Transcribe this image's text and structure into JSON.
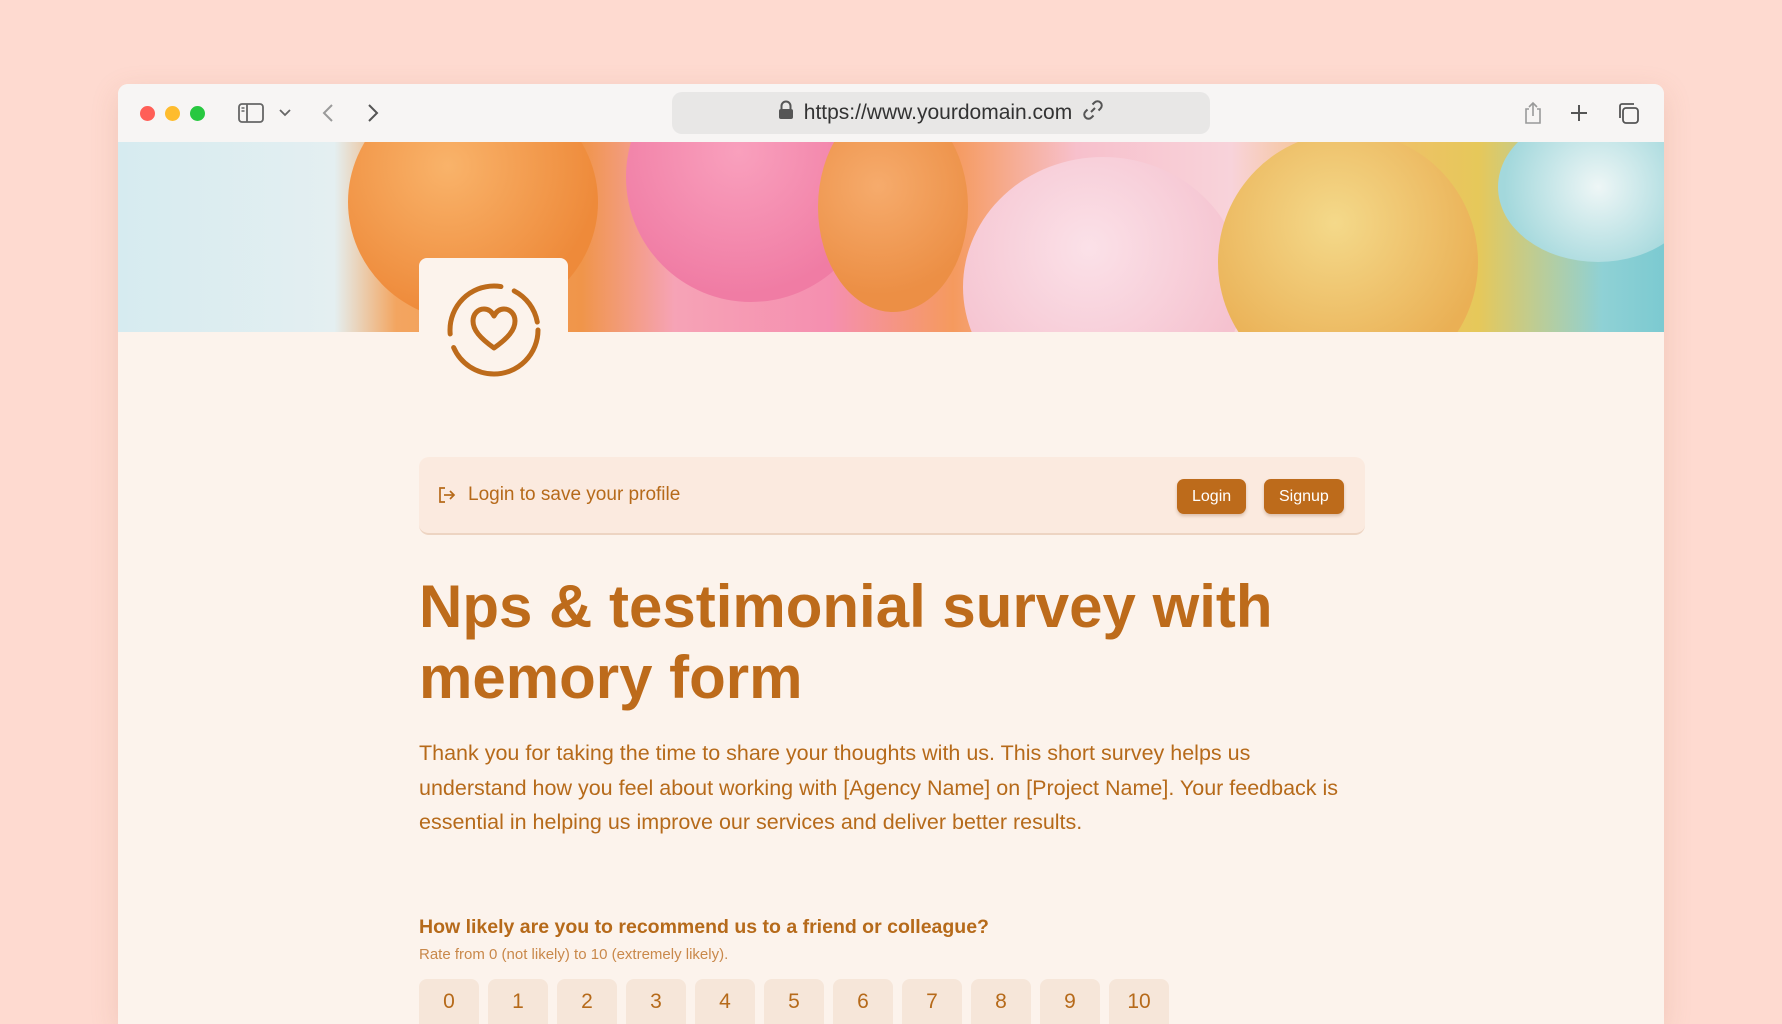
{
  "browser": {
    "url": "https://www.yourdomain.com",
    "icons": [
      "sidebar-icon",
      "chevron-down-icon",
      "back-icon",
      "forward-icon",
      "lock-icon",
      "link-icon",
      "share-icon",
      "plus-icon",
      "tabs-icon"
    ]
  },
  "login_bar": {
    "text": "Login to save your profile",
    "login_label": "Login",
    "signup_label": "Signup"
  },
  "form": {
    "title": "Nps & testimonial survey with memory form",
    "intro": "Thank you for taking the time to share your thoughts with us. This short survey helps us understand how you feel about working with [Agency Name] on [Project Name]. Your feedback is essential in helping us improve our services and deliver better results.",
    "question": "How likely are you to recommend us to a friend or colleague?",
    "hint": "Rate from 0 (not likely) to 10 (extremely likely).",
    "scale": [
      "0",
      "1",
      "2",
      "3",
      "4",
      "5",
      "6",
      "7",
      "8",
      "9",
      "10"
    ]
  },
  "colors": {
    "page_background": "#fedad0",
    "content_background": "#fcf3ec",
    "accent": "#bd6b1b",
    "text": "#b66a1a"
  }
}
